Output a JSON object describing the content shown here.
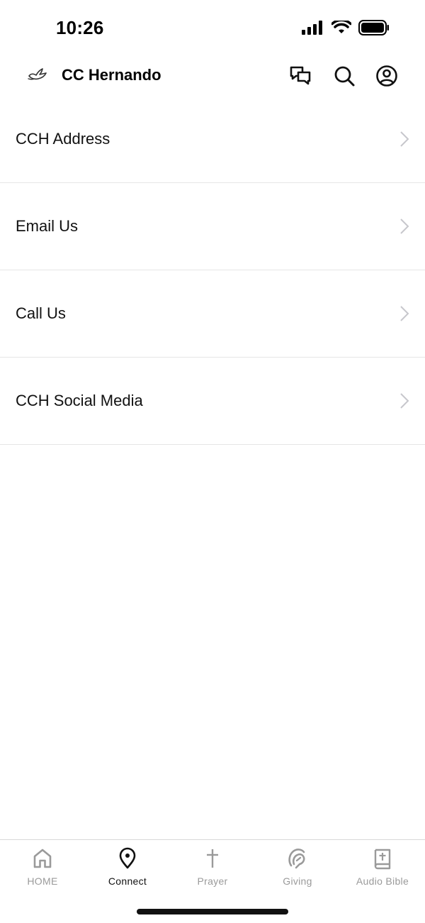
{
  "status_bar": {
    "time": "10:26"
  },
  "header": {
    "title": "CC Hernando",
    "logo_icon": "dove-icon",
    "actions": [
      "chat-icon",
      "search-icon",
      "profile-icon"
    ]
  },
  "menu": {
    "items": [
      {
        "label": "CCH Address"
      },
      {
        "label": "Email Us"
      },
      {
        "label": "Call Us"
      },
      {
        "label": "CCH Social Media"
      }
    ]
  },
  "tab_bar": {
    "active": "Connect",
    "tabs": [
      {
        "label": "HOME",
        "icon": "home-icon"
      },
      {
        "label": "Connect",
        "icon": "location-pin-icon"
      },
      {
        "label": "Prayer",
        "icon": "cross-icon"
      },
      {
        "label": "Giving",
        "icon": "giving-icon"
      },
      {
        "label": "Audio Bible",
        "icon": "bible-icon"
      }
    ]
  },
  "colors": {
    "active": "#111111",
    "inactive": "#9a9a9a",
    "divider": "#e6e6e6"
  }
}
